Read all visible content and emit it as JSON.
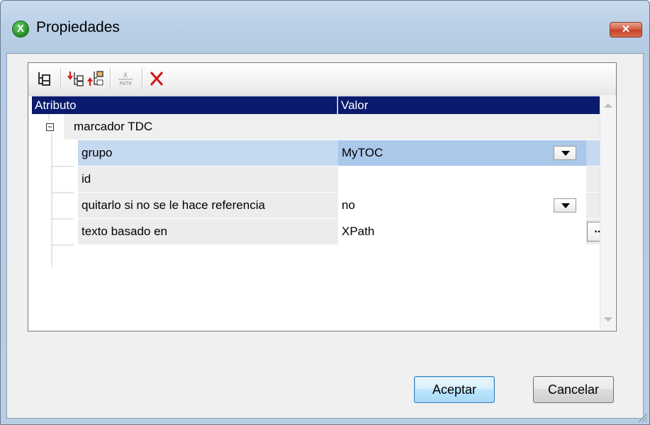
{
  "window": {
    "title": "Propiedades",
    "app_icon_glyph": "X",
    "close_glyph": "✕"
  },
  "toolbar": {
    "icons": [
      "tree-view-icon",
      "add-attribute-before-icon",
      "add-attribute-after-icon",
      "xpath-icon",
      "delete-icon"
    ],
    "xpath_top": "X",
    "xpath_bottom": "PATH"
  },
  "grid": {
    "headers": {
      "attribute": "Atributo",
      "value": "Valor"
    },
    "group": {
      "toggle": "−",
      "label": "marcador TDC"
    },
    "rows": [
      {
        "attribute": "grupo",
        "value": "MyTOC",
        "control": "dropdown",
        "selected": true
      },
      {
        "attribute": "id",
        "value": "",
        "control": "none",
        "selected": false
      },
      {
        "attribute": "quitarlo si no se le hace referencia",
        "value": "no",
        "control": "dropdown",
        "selected": false
      },
      {
        "attribute": "texto basado en",
        "value": "XPath",
        "control": "ellipsis",
        "selected": false
      }
    ],
    "ellipsis_label": "..."
  },
  "buttons": {
    "ok": "Aceptar",
    "cancel": "Cancelar"
  },
  "colors": {
    "header_bg": "#0a1b6e",
    "selected_row": "#c5d9f0",
    "selected_value": "#aac8ea",
    "title_bar": "#c9dbee"
  }
}
